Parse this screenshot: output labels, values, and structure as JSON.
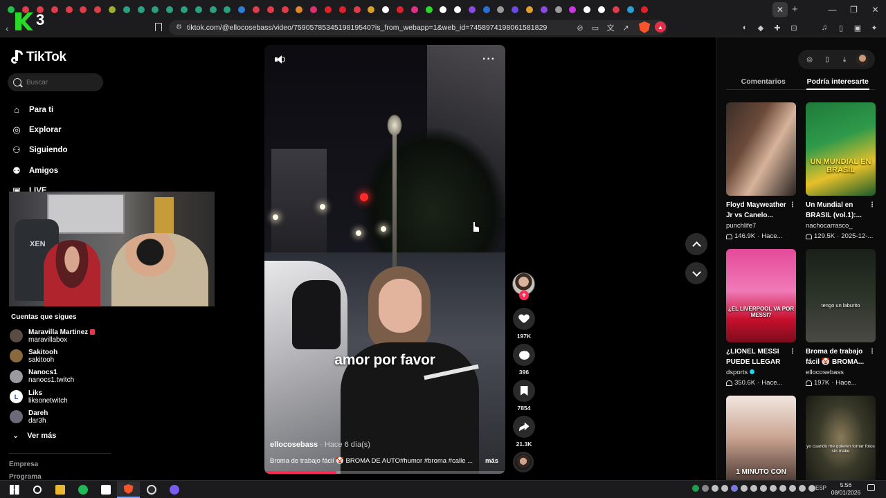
{
  "browser": {
    "url": "tiktok.com/@ellocosebass/video/7590578534519819540?is_from_webapp=1&web_id=7458974198061581829",
    "tab_colors": [
      "#1fbf4a",
      "#e23b4a",
      "#e23b4a",
      "#e23b4a",
      "#e23b4a",
      "#e23b4a",
      "#e23b4a",
      "#9ab02f",
      "#2b9f80",
      "#2b9f80",
      "#2b9f80",
      "#2b9f80",
      "#2b9f80",
      "#2b9f80",
      "#2b9f80",
      "#2b9f80",
      "#2b7fd6",
      "#e23b4a",
      "#e23b4a",
      "#e23b4a",
      "#e0862b",
      "#e0306a",
      "#e2202a",
      "#e2202a",
      "#e23b4a",
      "#d8a02b",
      "#ffffff",
      "#e2202a",
      "#e2308a",
      "#2bd92b",
      "#ffffff",
      "#ffffff",
      "#8a4ae2",
      "#2b6fd6",
      "#9a9a9a",
      "#6a4ae2",
      "#e0a02b",
      "#8a4ae2",
      "#9a9a9a",
      "#c83adf",
      "#ffffff",
      "#ffffff",
      "#e23b4a",
      "#2b9fd6",
      "#e2202a"
    ],
    "k3_label": "3"
  },
  "sidebar": {
    "brand": "TikTok",
    "search_placeholder": "Buscar",
    "nav": [
      {
        "label": "Para ti",
        "icon": "home-icon"
      },
      {
        "label": "Explorar",
        "icon": "compass-icon"
      },
      {
        "label": "Siguiendo",
        "icon": "following-icon"
      },
      {
        "label": "Amigos",
        "icon": "friends-icon"
      },
      {
        "label": "LIVE",
        "icon": "live-icon"
      }
    ],
    "following_title": "Cuentas que sigues",
    "following": [
      {
        "name": "Maravilla Martinez",
        "handle": "maravillabox",
        "color": "#5a4b44"
      },
      {
        "name": "Sakitooh",
        "handle": "sakitooh",
        "color": "#8a6a3c"
      },
      {
        "name": "Nanocs1",
        "handle": "nanocs1.twitch",
        "color": "#9a9aa0"
      },
      {
        "name": "Liks",
        "handle": "liksonetwitch",
        "color": "#ffffff",
        "letter": "L"
      },
      {
        "name": "Dareh",
        "handle": "dar3h",
        "color": "#6a6a78"
      }
    ],
    "see_more": "Ver más",
    "footer_1": "Empresa",
    "footer_2": "Programa"
  },
  "video": {
    "caption": "amor por favor",
    "author": "ellocosebass",
    "time": " · Hace 6 día(s)",
    "description": "Broma de trabajo fácil 🤡 BROMA DE AUTO#humor #broma #calle ...",
    "more": "más",
    "progress": 0.3,
    "likes": "197K",
    "comments": "396",
    "saves": "7854",
    "shares": "21.3K"
  },
  "right_panel": {
    "tabs": [
      "Comentarios",
      "Podría interesarte"
    ],
    "active_tab": 1,
    "cards": [
      {
        "title": "Floyd Mayweather Jr vs Canelo...",
        "author": "punchlife7",
        "views": "146.9K",
        "date": "Hace...",
        "overlay": ""
      },
      {
        "title": "Un Mundial en BRASIL (vol.1):...",
        "author": "nachocarrasco_",
        "views": "129.5K",
        "date": "2025-12-...",
        "overlay": "UN MUNDIAL EN BRASIL"
      },
      {
        "title": "¿LIONEL MESSI PUEDE LLEGAR A...",
        "author": "dsports",
        "views": "350.6K",
        "date": "Hace...",
        "overlay": "¿EL LIVERPOOL VA POR MESSI?"
      },
      {
        "title": "Broma de trabajo fácil 🤡 BROMA...",
        "author": "ellocosebass",
        "views": "197K",
        "date": "Hace...",
        "overlay": "tengo un laburito"
      },
      {
        "title": "",
        "author": "",
        "views": "",
        "date": "",
        "overlay": "1 MINUTO CON"
      },
      {
        "title": "",
        "author": "",
        "views": "",
        "date": "",
        "overlay": "yo cuando me quieren tomar fotos sin make"
      }
    ]
  },
  "taskbar": {
    "language": "ESP",
    "time": "5:56",
    "date": "08/01/2026"
  }
}
